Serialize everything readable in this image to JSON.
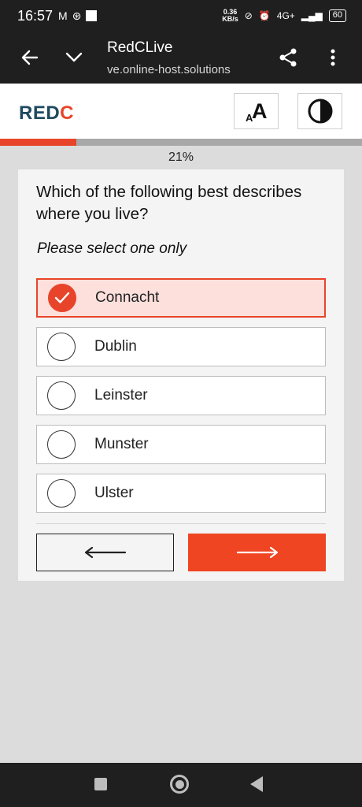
{
  "status_bar": {
    "time": "16:57",
    "speed_top": "0.36",
    "speed_bottom": "KB/s",
    "network": "4G+",
    "battery": "60"
  },
  "browser": {
    "title": "RedCLive",
    "url": "ve.online-host.solutions"
  },
  "header": {
    "logo_text": "RED",
    "logo_accent": "C",
    "text_size_label": "A"
  },
  "progress": {
    "value": 0.21,
    "label": "21%"
  },
  "question": {
    "text": "Which of the following best describes where you live?",
    "hint": "Please select one only",
    "options": [
      {
        "label": "Connacht",
        "selected": true
      },
      {
        "label": "Dublin",
        "selected": false
      },
      {
        "label": "Leinster",
        "selected": false
      },
      {
        "label": "Munster",
        "selected": false
      },
      {
        "label": "Ulster",
        "selected": false
      }
    ]
  },
  "colors": {
    "accent": "#e8442a",
    "selected_bg": "#fde0dc",
    "brand_dark": "#1e4a5e"
  },
  "icons": {
    "back": "arrow-left-icon",
    "next": "arrow-right-icon",
    "contrast": "contrast-icon",
    "share": "share-icon",
    "menu": "more-vertical-icon"
  }
}
